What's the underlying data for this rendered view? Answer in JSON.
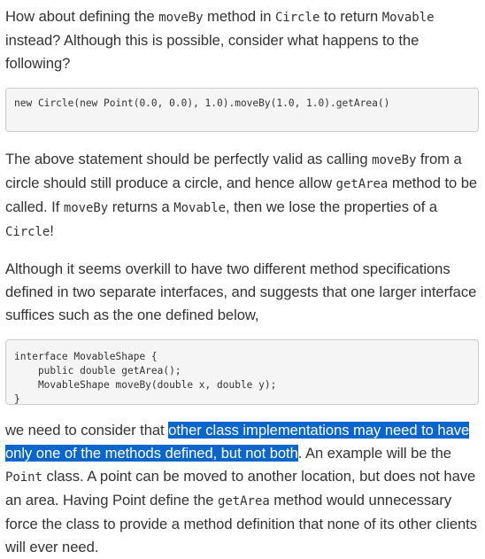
{
  "para1": {
    "t1": "How about defining the ",
    "c1": "moveBy",
    "t2": " method in ",
    "c2": "Circle",
    "t3": " to return ",
    "c3": "Movable",
    "t4": " instead? Although this is possible, consider what happens to the following?"
  },
  "code1": "new Circle(new Point(0.0, 0.0), 1.0).moveBy(1.0, 1.0).getArea()",
  "para2": {
    "t1": "The above statement should be perfectly valid as calling ",
    "c1": "moveBy",
    "t2": " from a circle should still produce a circle, and hence allow ",
    "c2": "getArea",
    "t3": " method to be called. If ",
    "c3": "moveBy",
    "t4": " returns a ",
    "c4": "Movable",
    "t5": ", then we lose the properties of a ",
    "c5": "Circle",
    "t6": "!"
  },
  "para3": "Although it seems overkill to have two different method specifications defined in two separate interfaces, and suggests that one larger interface suffices such as the one defined below,",
  "code2": "interface MovableShape {\n    public double getArea();\n    MovableShape moveBy(double x, double y);\n}",
  "para4": {
    "t1": "we need to consider that ",
    "highlight": "other class implementations may need to have only one of the methods defined, but not both",
    "t2": ". An example will be the ",
    "c1": "Point",
    "t3": " class. A point can be moved to another location, but does not have an area. Having Point define the ",
    "c2": "getArea",
    "t4": " method would unnecessary force the class to provide a method definition that none of its other clients will ever need."
  },
  "colors": {
    "text": "#333333",
    "selection": "#0a66cc",
    "code_background": "#f5f5f5",
    "code_border": "#cccccc"
  }
}
